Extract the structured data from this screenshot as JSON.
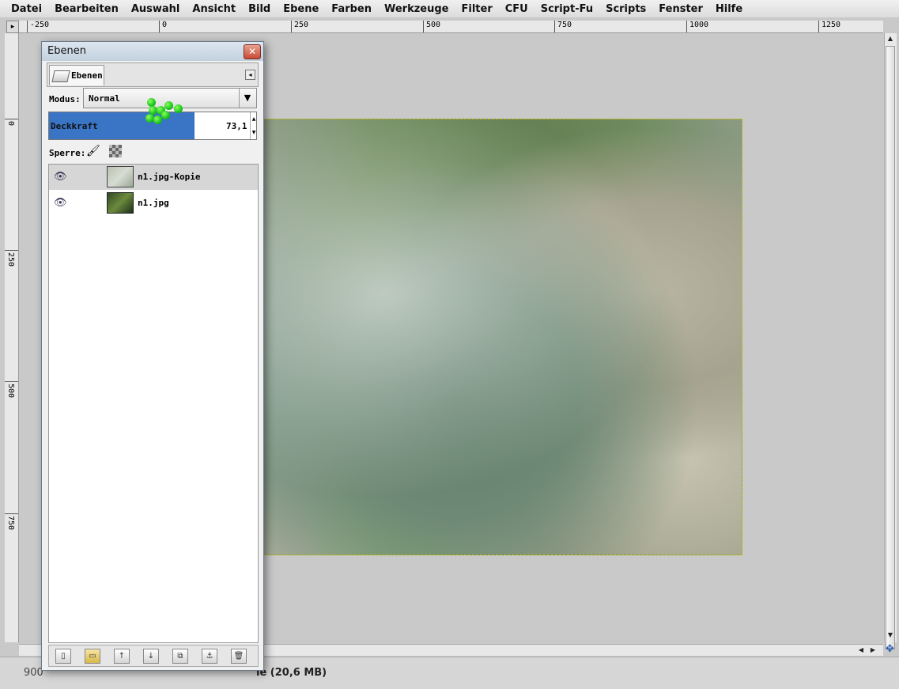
{
  "menubar": {
    "items": [
      "Datei",
      "Bearbeiten",
      "Auswahl",
      "Ansicht",
      "Bild",
      "Ebene",
      "Farben",
      "Werkzeuge",
      "Filter",
      "CFU",
      "Script-Fu",
      "Scripts",
      "Fenster",
      "Hilfe"
    ]
  },
  "ruler_top": {
    "labels": [
      "-250",
      "0",
      "250",
      "500",
      "750",
      "1000",
      "1250"
    ]
  },
  "ruler_left": {
    "labels": [
      "0",
      "250",
      "500",
      "750"
    ]
  },
  "dialog": {
    "title": "Ebenen",
    "tab_label": "Ebenen",
    "mode_label": "Modus:",
    "mode_value": "Normal",
    "opacity_label": "Deckkraft",
    "opacity_value": "73,1",
    "lock_label": "Sperre:",
    "layers": [
      {
        "name": "n1.jpg-Kopie",
        "selected": true
      },
      {
        "name": "n1.jpg",
        "selected": false
      }
    ]
  },
  "statusbar": {
    "zoom": "900",
    "text": "ie (20,6 MB)"
  },
  "colors": {
    "selection_blue": "#3a74c4",
    "cursor_green": "#19c41e"
  }
}
